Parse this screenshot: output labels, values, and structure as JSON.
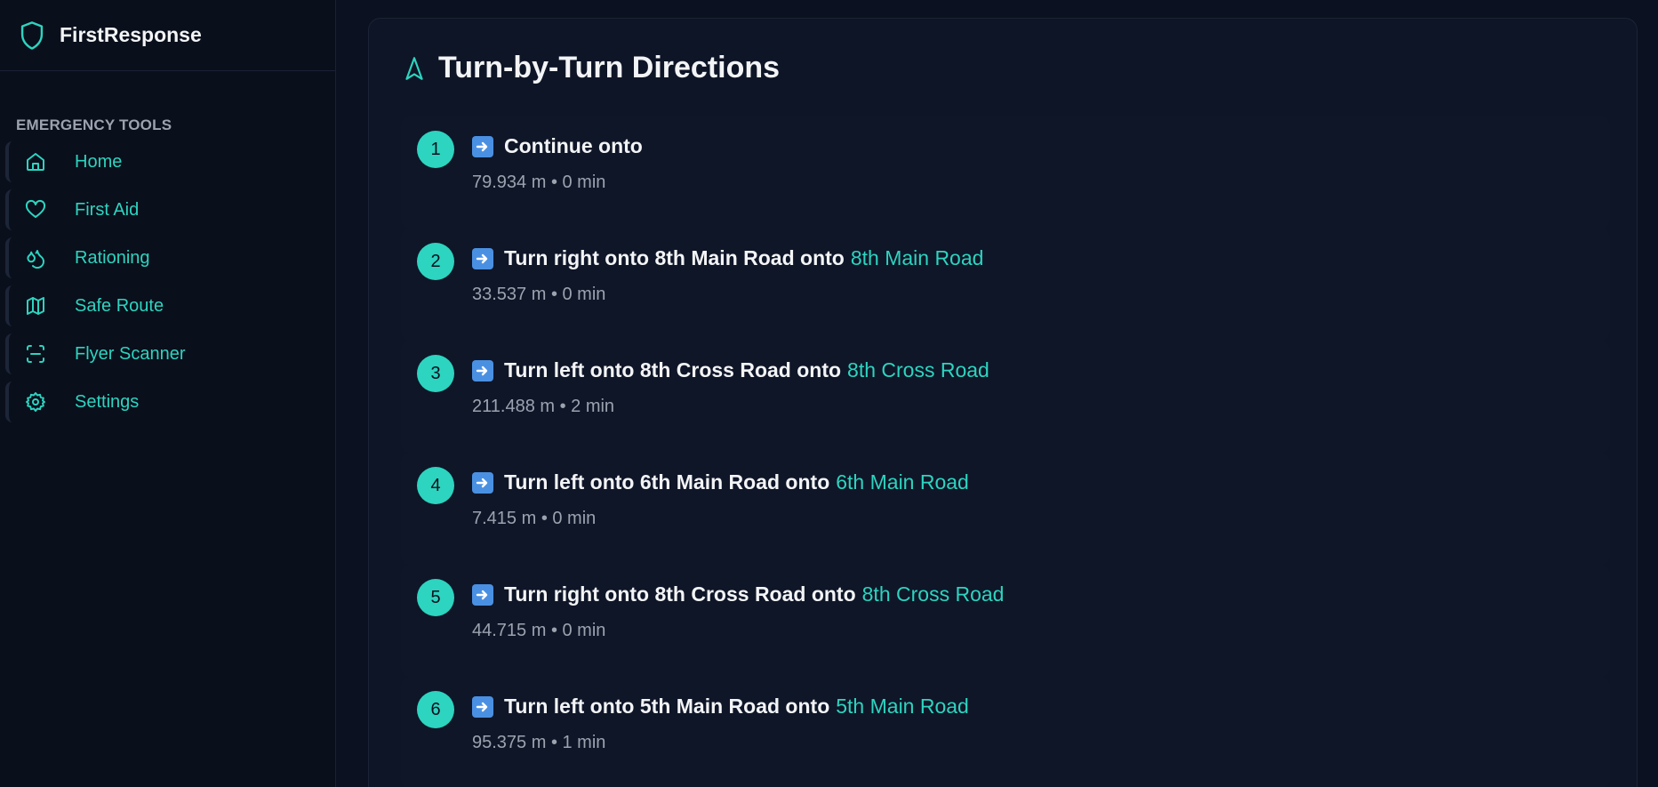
{
  "app": {
    "name": "FirstResponse"
  },
  "sidebar": {
    "section_label": "EMERGENCY TOOLS",
    "items": [
      {
        "label": "Home",
        "icon": "home-icon"
      },
      {
        "label": "First Aid",
        "icon": "heart-icon"
      },
      {
        "label": "Rationing",
        "icon": "droplets-icon"
      },
      {
        "label": "Safe Route",
        "icon": "map-icon"
      },
      {
        "label": "Flyer Scanner",
        "icon": "scan-icon"
      },
      {
        "label": "Settings",
        "icon": "gear-icon"
      }
    ]
  },
  "directions": {
    "title": "Turn-by-Turn Directions",
    "steps": [
      {
        "num": "1",
        "instruction": "Continue onto",
        "road": "",
        "meta": "79.934 m • 0 min"
      },
      {
        "num": "2",
        "instruction": "Turn right onto 8th Main Road onto",
        "road": "8th Main Road",
        "meta": "33.537 m • 0 min"
      },
      {
        "num": "3",
        "instruction": "Turn left onto 8th Cross Road onto",
        "road": "8th Cross Road",
        "meta": "211.488 m • 2 min"
      },
      {
        "num": "4",
        "instruction": "Turn left onto 6th Main Road onto",
        "road": "6th Main Road",
        "meta": "7.415 m • 0 min"
      },
      {
        "num": "5",
        "instruction": "Turn right onto 8th Cross Road onto",
        "road": "8th Cross Road",
        "meta": "44.715 m • 0 min"
      },
      {
        "num": "6",
        "instruction": "Turn left onto 5th Main Road onto",
        "road": "5th Main Road",
        "meta": "95.375 m • 1 min"
      }
    ]
  },
  "colors": {
    "accent": "#2dd4bf",
    "background": "#0b1120",
    "card": "#0e1526",
    "arrow_badge": "#4a90e2"
  }
}
